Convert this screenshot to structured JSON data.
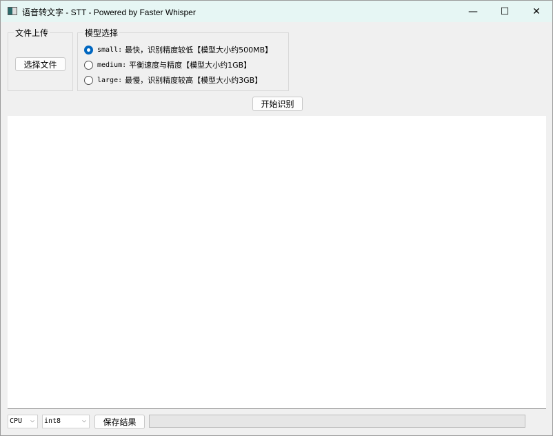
{
  "window": {
    "title": "语音转文字 - STT - Powered by Faster Whisper",
    "minimize": "—",
    "maximize": "☐",
    "close": "✕"
  },
  "upload": {
    "legend": "文件上传",
    "button": "选择文件"
  },
  "model": {
    "legend": "模型选择",
    "options": [
      {
        "name": "small:",
        "desc": "最快，识别精度较低【模型大小约500MB】",
        "selected": true
      },
      {
        "name": "medium:",
        "desc": "平衡速度与精度【模型大小约1GB】",
        "selected": false
      },
      {
        "name": "large:",
        "desc": "最慢，识别精度较高【模型大小约3GB】",
        "selected": false
      }
    ]
  },
  "start_button": "开始识别",
  "output_text": "",
  "bottom": {
    "device": "CPU",
    "compute_type": "int8",
    "save_button": "保存结果",
    "progress": 0
  }
}
